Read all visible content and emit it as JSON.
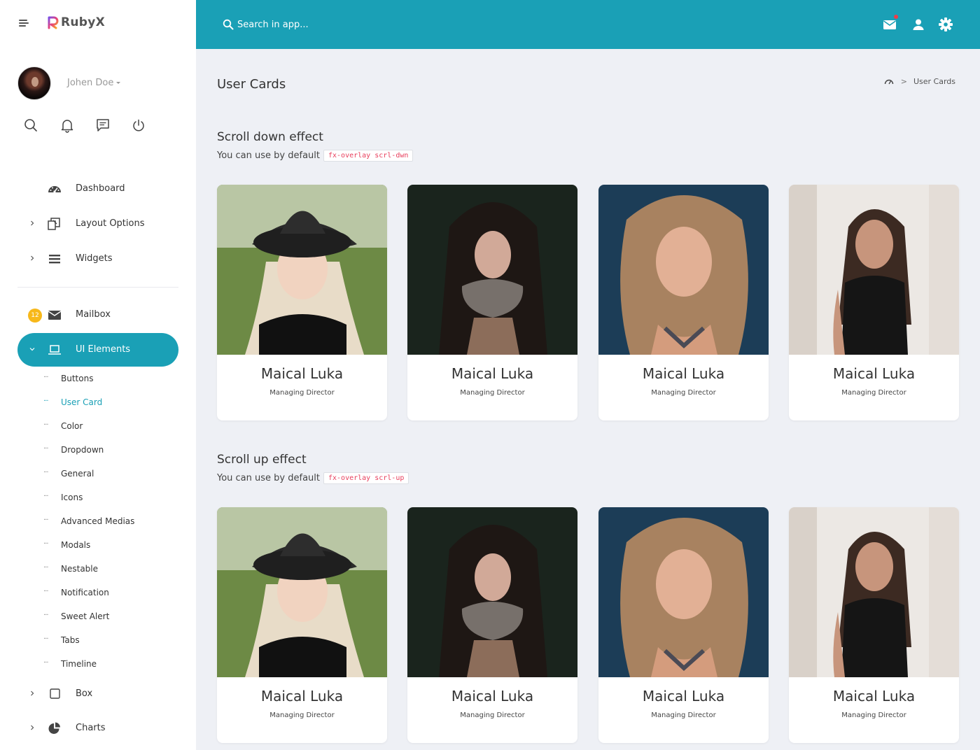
{
  "app": {
    "brand": "RubyX"
  },
  "colors": {
    "accent": "#1aa0b6",
    "badge": "#f7b81a",
    "code_text": "#e83e5c",
    "notification_dot": "#ee3d48"
  },
  "profile": {
    "name": "Johen Doe"
  },
  "search": {
    "placeholder": "Search in app..."
  },
  "sidebar": {
    "items": [
      {
        "label": "Dashboard",
        "icon": "dashboard-icon"
      },
      {
        "label": "Layout Options",
        "icon": "layout-icon"
      },
      {
        "label": "Widgets",
        "icon": "widgets-icon"
      },
      {
        "label": "Mailbox",
        "icon": "mail-icon",
        "badge": "12"
      },
      {
        "label": "UI Elements",
        "icon": "laptop-icon"
      },
      {
        "label": "Box",
        "icon": "box-icon"
      },
      {
        "label": "Charts",
        "icon": "pie-chart-icon"
      }
    ],
    "sub_items": [
      {
        "label": "Buttons"
      },
      {
        "label": "User Card"
      },
      {
        "label": "Color"
      },
      {
        "label": "Dropdown"
      },
      {
        "label": "General"
      },
      {
        "label": "Icons"
      },
      {
        "label": "Advanced Medias"
      },
      {
        "label": "Modals"
      },
      {
        "label": "Nestable"
      },
      {
        "label": "Notification"
      },
      {
        "label": "Sweet Alert"
      },
      {
        "label": "Tabs"
      },
      {
        "label": "Timeline"
      }
    ]
  },
  "page": {
    "title": "User Cards",
    "breadcrumb": {
      "current": "User Cards"
    }
  },
  "sections": [
    {
      "title": "Scroll down effect",
      "desc": "You can use by default",
      "code": "fx-overlay scrl-dwn",
      "cards": [
        {
          "name": "Maical Luka",
          "role": "Managing Director"
        },
        {
          "name": "Maical Luka",
          "role": "Managing Director"
        },
        {
          "name": "Maical Luka",
          "role": "Managing Director"
        },
        {
          "name": "Maical Luka",
          "role": "Managing Director"
        }
      ]
    },
    {
      "title": "Scroll up effect",
      "desc": "You can use by default",
      "code": "fx-overlay scrl-up",
      "cards": [
        {
          "name": "Maical Luka",
          "role": "Managing Director"
        },
        {
          "name": "Maical Luka",
          "role": "Managing Director"
        },
        {
          "name": "Maical Luka",
          "role": "Managing Director"
        },
        {
          "name": "Maical Luka",
          "role": "Managing Director"
        }
      ]
    }
  ]
}
